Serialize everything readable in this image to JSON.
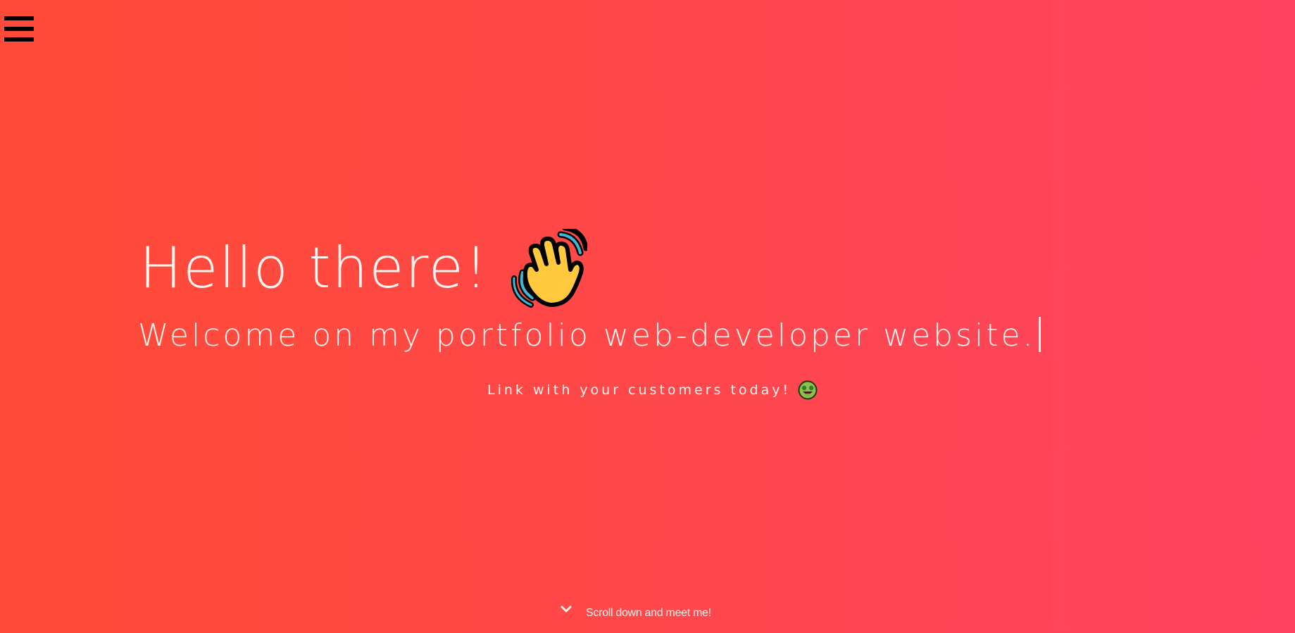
{
  "nav": {
    "menu_icon": "hamburger-menu-icon"
  },
  "hero": {
    "headline": "Hello there!",
    "headline_icon": "waving-hand-icon",
    "welcome": "Welcome on my portfolio web-developer website.",
    "tagline": "Link with your customers today!",
    "tagline_icon": "money-mouth-face-icon"
  },
  "scroll_hint": {
    "icon": "chevron-down-icon",
    "label": "Scroll down and meet me!"
  },
  "colors": {
    "gradient_start": "#ff4b37",
    "gradient_end": "#ff4462",
    "text": "#fff0ea",
    "menu": "#000000"
  }
}
